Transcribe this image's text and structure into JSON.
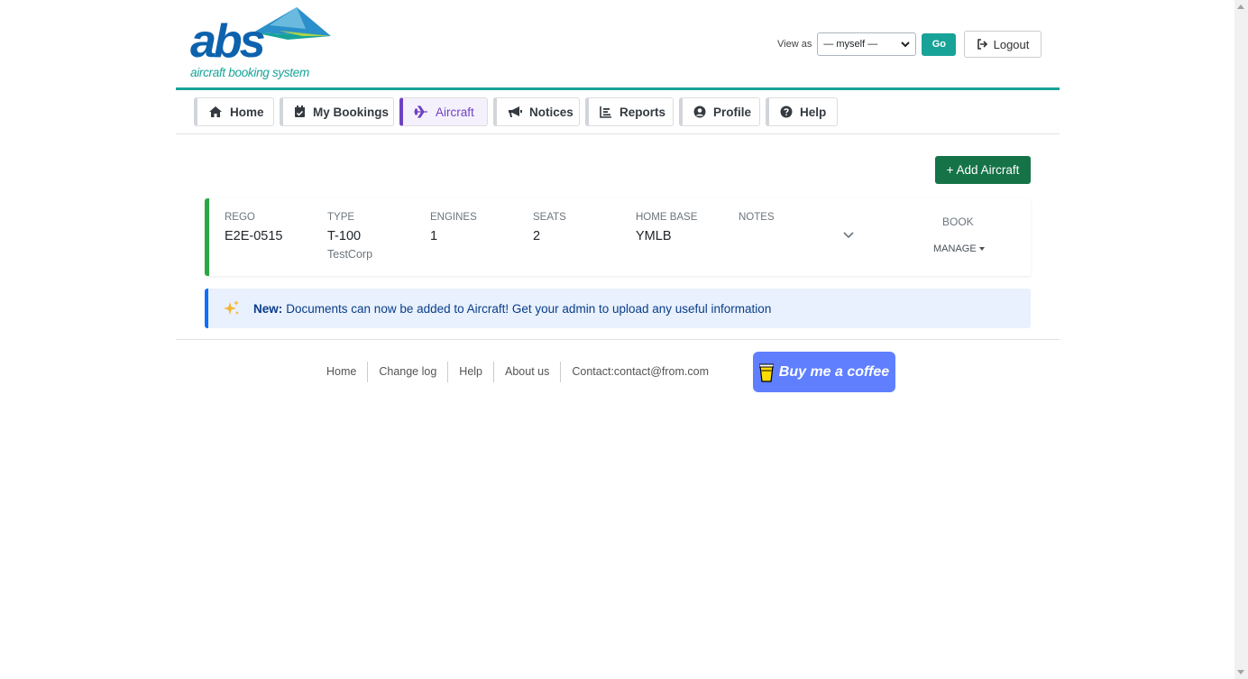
{
  "logo": {
    "word": "abs",
    "tagline": "aircraft booking system"
  },
  "header": {
    "view_as_label": "View as",
    "view_as_selected": "— myself —",
    "go_label": "Go",
    "logout_label": "Logout"
  },
  "nav": {
    "tabs": [
      {
        "label": "Home",
        "icon": "home-icon",
        "active": false
      },
      {
        "label": "My Bookings",
        "icon": "calendar-check-icon",
        "active": false
      },
      {
        "label": "Aircraft",
        "icon": "plane-icon",
        "active": true
      },
      {
        "label": "Notices",
        "icon": "megaphone-icon",
        "active": false
      },
      {
        "label": "Reports",
        "icon": "chart-icon",
        "active": false
      },
      {
        "label": "Profile",
        "icon": "user-circle-icon",
        "active": false
      },
      {
        "label": "Help",
        "icon": "question-circle-icon",
        "active": false
      }
    ]
  },
  "toolbar": {
    "add_aircraft_label": "+ Add Aircraft"
  },
  "aircraft": {
    "rego_header": "REGO",
    "rego": "E2E-0515",
    "type_header": "TYPE",
    "type": "T-100",
    "manufacturer": "TestCorp",
    "engines_header": "ENGINES",
    "engines": "1",
    "seats_header": "SEATS",
    "seats": "2",
    "home_base_header": "HOME BASE",
    "home_base": "YMLB",
    "notes_header": "NOTES",
    "notes": "",
    "book_label": "BOOK",
    "manage_label": "MANAGE"
  },
  "notice": {
    "bold": "New:",
    "text": "Documents can now be added to Aircraft! Get your admin to upload any useful information"
  },
  "footer": {
    "links": [
      "Home",
      "Change log",
      "Help",
      "About us",
      "Contact:contact@from.com"
    ],
    "coffee_label": "Buy me a coffee"
  },
  "colors": {
    "brand_teal": "#17a398",
    "brand_blue": "#0d62ad",
    "active_tab": "#6f42c1",
    "add_button": "#157347",
    "card_accent": "#28a745",
    "notice_accent": "#0d6efd",
    "coffee_button": "#5f7fff"
  }
}
